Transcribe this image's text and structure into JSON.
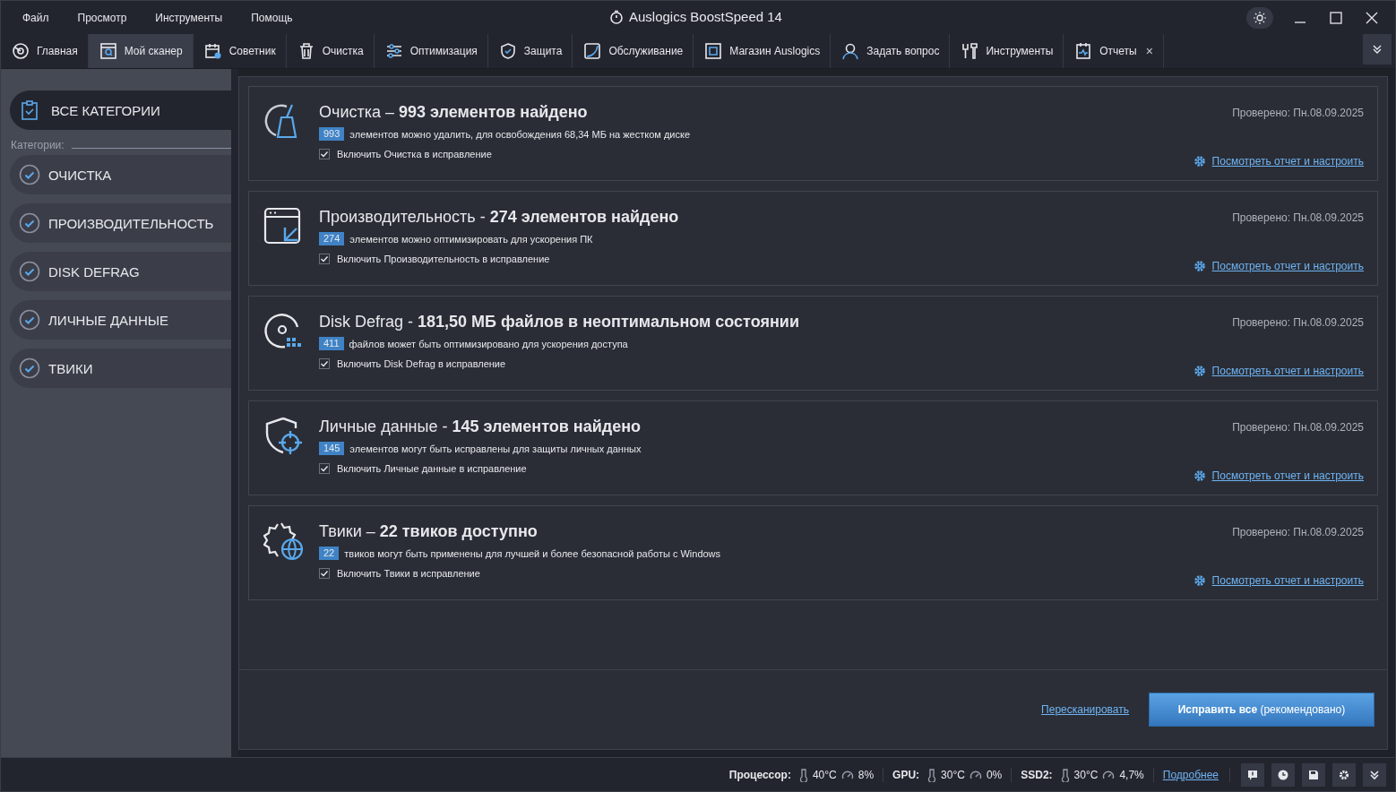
{
  "menu": [
    "Файл",
    "Просмотр",
    "Инструменты",
    "Помощь"
  ],
  "window": {
    "title": "Auslogics BoostSpeed 14"
  },
  "tabs": [
    {
      "kind": "home",
      "label": "Главная",
      "selected": false
    },
    {
      "kind": "scanner",
      "label": "Мой сканер",
      "selected": true
    },
    {
      "kind": "advisor",
      "label": "Советник",
      "selected": false
    },
    {
      "kind": "trash",
      "label": "Очистка",
      "selected": false
    },
    {
      "kind": "sliders",
      "label": "Оптимизация",
      "selected": false
    },
    {
      "kind": "shield",
      "label": "Защита",
      "selected": false
    },
    {
      "kind": "service",
      "label": "Обслуживание",
      "selected": false
    },
    {
      "kind": "store",
      "label": "Магазин Auslogics",
      "selected": false
    },
    {
      "kind": "person",
      "label": "Задать вопрос",
      "selected": false
    },
    {
      "kind": "tools",
      "label": "Инструменты",
      "selected": false
    },
    {
      "kind": "report",
      "label": "Отчеты",
      "selected": false,
      "close": "×"
    }
  ],
  "sidebar": {
    "all": {
      "label": "ВСЕ КАТЕГОРИИ",
      "selected": true
    },
    "categories_label": "Категории:",
    "items": [
      {
        "label": "ОЧИСТКА",
        "checked": true,
        "selected": false
      },
      {
        "label": "ПРОИЗВОДИТЕЛЬНОСТЬ",
        "checked": true,
        "selected": false
      },
      {
        "label": "DISK DEFRAG",
        "checked": true,
        "selected": false
      },
      {
        "label": "ЛИЧНЫЕ ДАННЫЕ",
        "checked": true,
        "selected": false
      },
      {
        "label": "ТВИКИ",
        "checked": true,
        "selected": false
      }
    ]
  },
  "cards": [
    {
      "kind": "cleanup",
      "title": "Очистка – **993 элементов найдено**",
      "count": "993",
      "description": "элементов можно удалить, для освобождения 68,34 МБ на жестком диске",
      "include": {
        "label": "Включить Очистка в исправление",
        "checked": true
      },
      "checked_date": "Проверено: Пн.08.09.2025",
      "link": "Посмотреть отчет и настроить"
    },
    {
      "kind": "performance",
      "title": "Производительность - **274 элементов найдено**",
      "count": "274",
      "description": "элементов можно оптимизировать для ускорения ПК",
      "include": {
        "label": "Включить Производительность в исправление",
        "checked": true
      },
      "checked_date": "Проверено: Пн.08.09.2025",
      "link": "Посмотреть отчет и настроить"
    },
    {
      "kind": "defrag",
      "title": "Disk Defrag - **181,50 МБ файлов в неоптимальном состоянии**",
      "count": "411",
      "description": "файлов может быть оптимизировано для ускорения доступа",
      "include": {
        "label": "Включить Disk Defrag в исправление",
        "checked": true
      },
      "checked_date": "Проверено: Пн.08.09.2025",
      "link": "Посмотреть отчет и настроить"
    },
    {
      "kind": "privacy",
      "title": "Личные данные - **145 элементов найдено**",
      "count": "145",
      "description": "элементов могут быть исправлены для защиты личных данных",
      "include": {
        "label": "Включить Личные данные в исправление",
        "checked": true
      },
      "checked_date": "Проверено: Пн.08.09.2025",
      "link": "Посмотреть отчет и настроить"
    },
    {
      "kind": "tweaks",
      "title": "Твики – **22 твиков доступно**",
      "count": "22",
      "description": "твиков могут быть применены для лучшей и более безопасной работы с Windows",
      "include": {
        "label": "Включить Твики в исправление",
        "checked": true
      },
      "checked_date": "Проверено: Пн.08.09.2025",
      "link": "Посмотреть отчет и настроить"
    }
  ],
  "footer": {
    "rescan": "Пересканировать",
    "fix_button": "**Исправить все** (рекомендовано)"
  },
  "status_bar": {
    "metrics": [
      {
        "label": "Процессор:",
        "temperature": "40°C",
        "load": "8%"
      },
      {
        "label": "GPU:",
        "temperature": "30°C",
        "load": "0%"
      },
      {
        "label": "SSD2:",
        "temperature": "30°C",
        "load": "4,7%"
      }
    ],
    "details_link": "Подробнее"
  }
}
